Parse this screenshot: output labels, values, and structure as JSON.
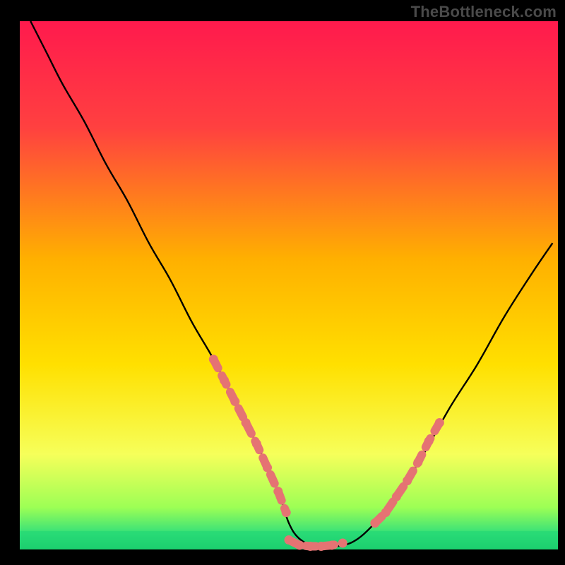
{
  "watermark": "TheBottleneck.com",
  "chart_data": {
    "type": "line",
    "title": "",
    "xlabel": "",
    "ylabel": "",
    "xlim": [
      0,
      100
    ],
    "ylim": [
      0,
      100
    ],
    "background_gradient": {
      "stops": [
        {
          "offset": 0.0,
          "color": "#ff1a4d"
        },
        {
          "offset": 0.2,
          "color": "#ff4040"
        },
        {
          "offset": 0.45,
          "color": "#ffb000"
        },
        {
          "offset": 0.65,
          "color": "#ffe000"
        },
        {
          "offset": 0.82,
          "color": "#f6ff5a"
        },
        {
          "offset": 0.92,
          "color": "#9dff55"
        },
        {
          "offset": 0.97,
          "color": "#34e07a"
        },
        {
          "offset": 1.0,
          "color": "#18c76a"
        }
      ]
    },
    "series": [
      {
        "name": "curve",
        "x": [
          2,
          5,
          8,
          12,
          16,
          20,
          24,
          28,
          32,
          36,
          40,
          44,
          48,
          50,
          52,
          55,
          58,
          62,
          66,
          70,
          75,
          80,
          85,
          90,
          95,
          99
        ],
        "y": [
          100,
          94,
          88,
          81,
          73,
          66,
          58,
          51,
          43,
          36,
          28,
          20,
          11,
          5,
          2,
          0.5,
          0.5,
          1.5,
          5,
          10,
          18,
          27,
          35,
          44,
          52,
          58
        ]
      },
      {
        "name": "highlight-left",
        "x": [
          36,
          38,
          40,
          42,
          44,
          46,
          48,
          49.5
        ],
        "y": [
          36,
          32,
          28,
          24,
          20,
          15.5,
          11,
          7
        ]
      },
      {
        "name": "highlight-bottom",
        "x": [
          50,
          52,
          54,
          56,
          58,
          60
        ],
        "y": [
          1.8,
          0.8,
          0.6,
          0.6,
          0.8,
          1.2
        ]
      },
      {
        "name": "highlight-right",
        "x": [
          66,
          68,
          70,
          72,
          74,
          76,
          78
        ],
        "y": [
          5,
          7,
          10,
          13,
          16.5,
          20.5,
          24
        ]
      }
    ]
  }
}
